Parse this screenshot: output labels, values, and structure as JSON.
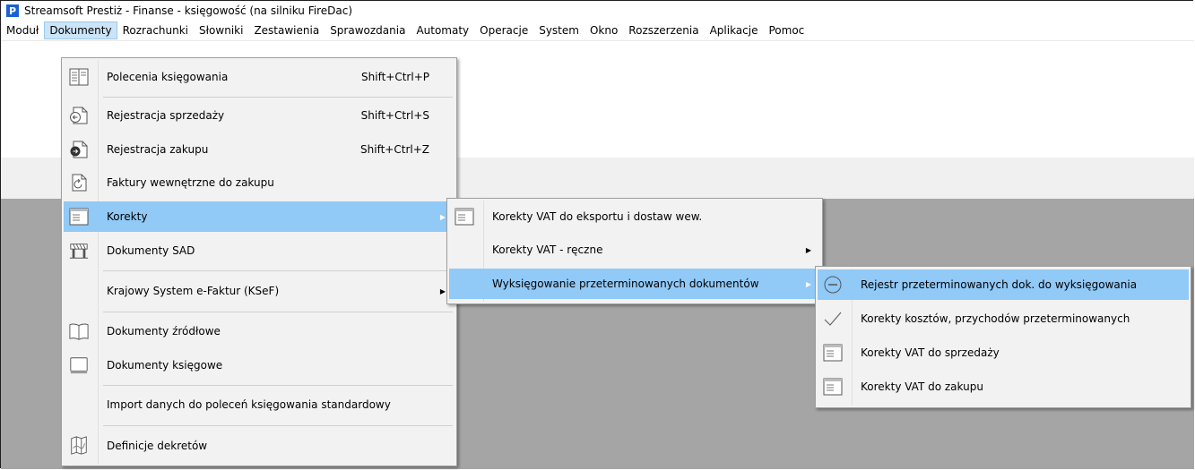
{
  "window": {
    "title": "Streamsoft Prestiż - Finanse - księgowość (na silniku FireDac)",
    "logo_letter": "P"
  },
  "menubar": [
    "Moduł",
    "Dokumenty",
    "Rozrachunki",
    "Słowniki",
    "Zestawienia",
    "Sprawozdania",
    "Automaty",
    "Operacje",
    "System",
    "Okno",
    "Rozszerzenia",
    "Aplikacje",
    "Pomoc"
  ],
  "menu_dokumenty": [
    {
      "label": "Polecenia księgowania",
      "shortcut": "Shift+Ctrl+P",
      "icon": "ledger-icon"
    },
    {
      "label": "Rejestracja sprzedaży",
      "shortcut": "Shift+Ctrl+S",
      "icon": "sale-doc-icon"
    },
    {
      "label": "Rejestracja zakupu",
      "shortcut": "Shift+Ctrl+Z",
      "icon": "purchase-doc-icon"
    },
    {
      "label": "Faktury wewnętrzne do zakupu",
      "shortcut": "",
      "icon": "refresh-doc-icon"
    },
    {
      "label": "Korekty",
      "shortcut": "",
      "icon": "list-doc-icon"
    },
    {
      "label": "Dokumenty SAD",
      "shortcut": "",
      "icon": "sad-gate-icon"
    },
    {
      "label": "Krajowy System e-Faktur (KSeF)",
      "shortcut": "",
      "icon": ""
    },
    {
      "label": "Dokumenty źródłowe",
      "shortcut": "",
      "icon": "book-icon"
    },
    {
      "label": "Dokumenty księgowe",
      "shortcut": "",
      "icon": "blank-doc-icon"
    },
    {
      "label": "Import danych do poleceń księgowania standardowy",
      "shortcut": "",
      "icon": ""
    },
    {
      "label": "Definicje dekretów",
      "shortcut": "",
      "icon": "map-book-icon"
    }
  ],
  "menu_korekty": [
    {
      "label": "Korekty VAT do eksportu i dostaw wew.",
      "icon": "list-doc-icon"
    },
    {
      "label": "Korekty VAT - ręczne",
      "icon": ""
    },
    {
      "label": "Wyksięgowanie przeterminowanych dokumentów",
      "icon": ""
    }
  ],
  "menu_wyksiegowanie": [
    {
      "label": "Rejestr przeterminowanych dok. do wyksięgowania",
      "icon": "minus-circle-icon"
    },
    {
      "label": "Korekty kosztów, przychodów przeterminowanych",
      "icon": "check-icon"
    },
    {
      "label": "Korekty VAT do sprzedaży",
      "icon": "list-doc-icon"
    },
    {
      "label": "Korekty VAT do zakupu",
      "icon": "list-doc-icon"
    }
  ],
  "colors": {
    "highlight": "#91c9f7",
    "menubar_active": "#cce4f7",
    "desktop": "#a5a5a5"
  }
}
